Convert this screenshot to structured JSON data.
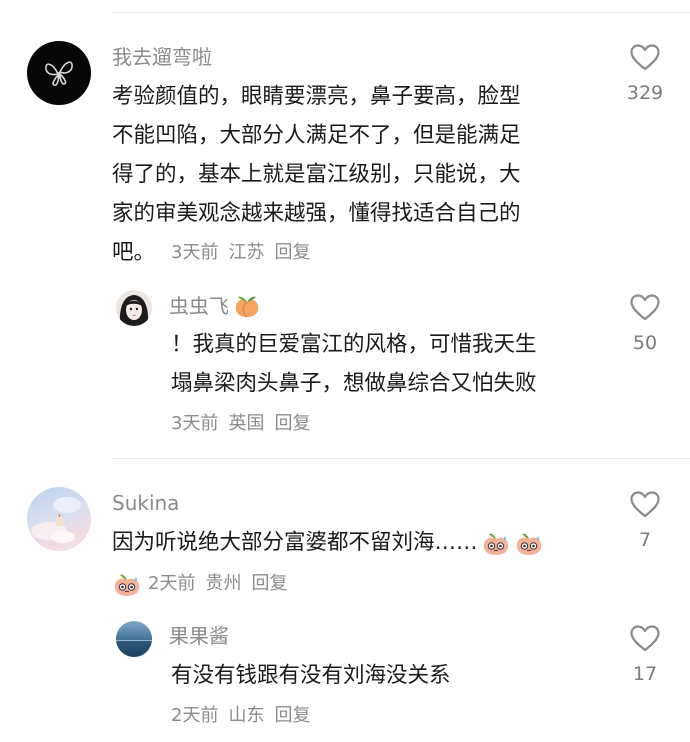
{
  "comments": [
    {
      "username": "我去遛弯啦",
      "lines": [
        "考验颜值的，眼睛要漂亮，鼻子要高，脸型",
        "不能凹陷，大部分人满足不了，但是能满足",
        "得了的，基本上就是富江级别，只能说，大",
        "家的审美观念越来越强，懂得找适合自己的",
        "吧。"
      ],
      "time": "3天前",
      "location": "江苏",
      "reply": "回复",
      "likes": "329",
      "reply_item": {
        "username": "虫虫飞",
        "lines": [
          "！我真的巨爱富江的风格，可惜我天生",
          "塌鼻梁肉头鼻子，想做鼻综合又怕失败"
        ],
        "time": "3天前",
        "location": "英国",
        "reply": "回复",
        "likes": "50"
      }
    },
    {
      "username": "Sukina",
      "text": "因为听说绝大部分富婆都不留刘海……",
      "time": "2天前",
      "location": "贵州",
      "reply": "回复",
      "likes": "7",
      "reply_item": {
        "username": "果果酱",
        "text": "有没有钱跟有没有刘海没关系",
        "time": "2天前",
        "location": "山东",
        "reply": "回复",
        "likes": "17"
      }
    }
  ],
  "colors": {
    "name": "#8b8b8b",
    "text": "#1a1a1a",
    "divider": "#ececec"
  }
}
